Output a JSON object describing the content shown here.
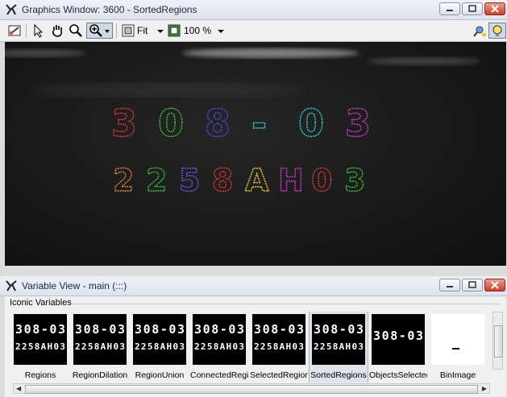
{
  "graphics_window": {
    "title": "Graphics Window: 3600 - SortedRegions",
    "toolbar": {
      "zoom_mode": "Fit",
      "zoom_level": "100 %"
    },
    "image": {
      "top_row_text": "308-03",
      "bottom_row_text": "2258AH03",
      "top_row_colors": [
        "#e23a3a",
        "#3ac43a",
        "#4a4ae8",
        "#3ad0d0",
        "#d23ad2",
        "#e0d23a"
      ],
      "bottom_row_colors": [
        "#e8823a",
        "#3ac43a",
        "#6a5ae8",
        "#e23a3a",
        "#e8c83a",
        "#d23ad2",
        "#e23a3a",
        "#3ac43a"
      ]
    }
  },
  "variable_view": {
    "title": "Variable View - main (:::)",
    "group_label": "Iconic Variables",
    "variables": [
      {
        "label": "Regions",
        "line1": "308-03",
        "line2": "2258AH03",
        "selected": false,
        "background": "black"
      },
      {
        "label": "RegionDilation",
        "line1": "308-03",
        "line2": "2258AH03",
        "selected": false,
        "background": "black"
      },
      {
        "label": "RegionUnion",
        "line1": "308-03",
        "line2": "2258AH03",
        "selected": false,
        "background": "black"
      },
      {
        "label": "ConnectedRegions",
        "line1": "308-03",
        "line2": "2258AH03",
        "selected": false,
        "background": "black"
      },
      {
        "label": "SelectedRegions",
        "line1": "308-03",
        "line2": "2258AH03",
        "selected": false,
        "background": "black"
      },
      {
        "label": "SortedRegions",
        "line1": "308-03",
        "line2": "2258AH03",
        "selected": true,
        "background": "black"
      },
      {
        "label": "ObjectsSelected",
        "line1": "308-03",
        "line2": "",
        "selected": false,
        "background": "black"
      },
      {
        "label": "BinImage",
        "line1": "",
        "line2": "",
        "selected": false,
        "background": "white"
      }
    ]
  }
}
